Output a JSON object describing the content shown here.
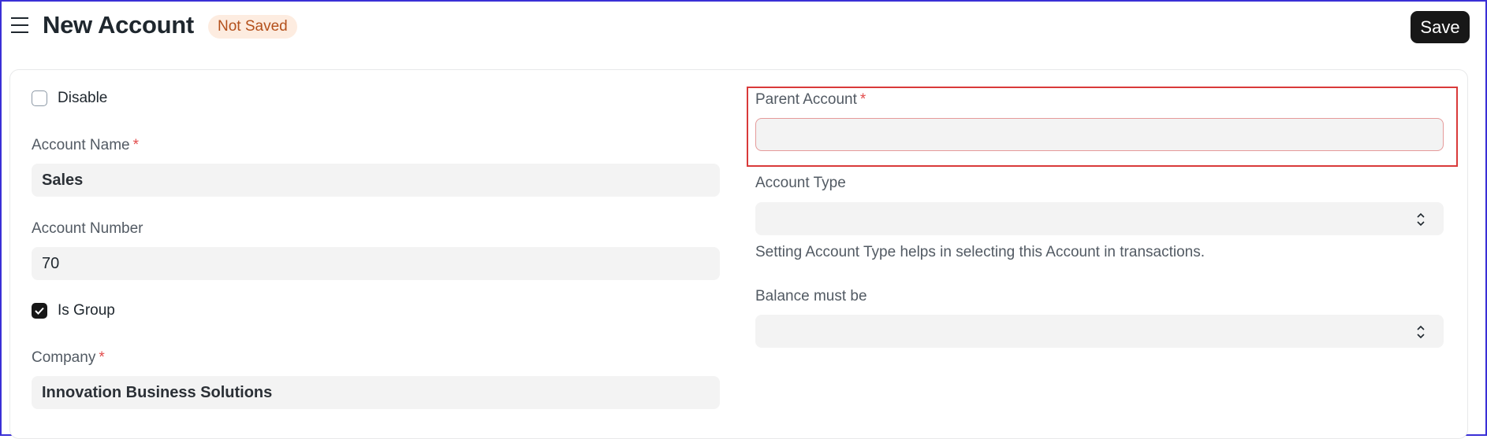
{
  "header": {
    "title": "New Account",
    "status": "Not Saved",
    "save_label": "Save"
  },
  "form": {
    "disable": {
      "label": "Disable",
      "checked": false
    },
    "account_name": {
      "label": "Account Name",
      "required": "*",
      "value": "Sales"
    },
    "account_number": {
      "label": "Account Number",
      "value": "70"
    },
    "is_group": {
      "label": "Is Group",
      "checked": true
    },
    "company": {
      "label": "Company",
      "required": "*",
      "value": "Innovation Business Solutions"
    },
    "parent_account": {
      "label": "Parent Account",
      "required": "*",
      "value": ""
    },
    "account_type": {
      "label": "Account Type",
      "value": "",
      "help": "Setting Account Type helps in selecting this Account in transactions."
    },
    "balance_must_be": {
      "label": "Balance must be",
      "value": ""
    }
  },
  "colors": {
    "badge_bg": "#fdece0",
    "badge_text": "#b4501b",
    "primary": "#171717",
    "required": "#e24c4c",
    "highlight": "#d93a3a"
  }
}
